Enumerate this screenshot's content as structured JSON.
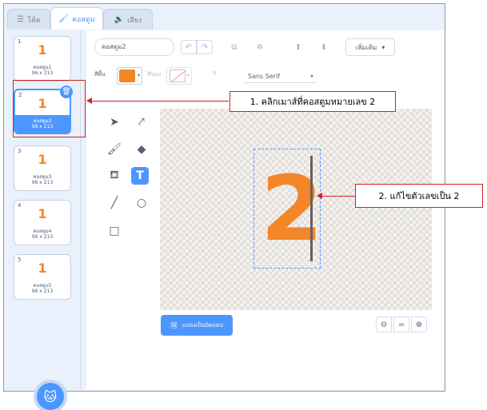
{
  "tabs": [
    {
      "label": "โค้ด",
      "icon": "code-icon"
    },
    {
      "label": "คอสตูม",
      "icon": "brush-icon"
    },
    {
      "label": "เสียง",
      "icon": "speaker-icon"
    }
  ],
  "costumes": [
    {
      "num": "1",
      "glyph": "1",
      "name": "คอสตูม1",
      "size": "96 x 213"
    },
    {
      "num": "2",
      "glyph": "1",
      "name": "คอสตูม2",
      "size": "96 x 213"
    },
    {
      "num": "3",
      "glyph": "1",
      "name": "คอสตูม3",
      "size": "96 x 213"
    },
    {
      "num": "4",
      "glyph": "1",
      "name": "คอสตูม4",
      "size": "96 x 213"
    },
    {
      "num": "5",
      "glyph": "1",
      "name": "คอสตูม5",
      "size": "96 x 213"
    }
  ],
  "editor": {
    "costume_name": "คอสตูม2",
    "more_label": "เพิ่มเติม",
    "fill_label": "สีพื้น",
    "outline_label": "สีขอบ",
    "outline_width": "0",
    "font": "Sans Serif",
    "canvas_text": "2",
    "bitmap_label": "แปลงเป็นบิตแมป",
    "zoom_equal": "="
  },
  "colors": {
    "accent": "#4c97ff",
    "fill": "#f4862a",
    "annotation": "#d32222"
  },
  "annotations": {
    "step1": "1. คลิกเมาส์ที่คอสตูมหมายเลข 2",
    "step2": "2. แก้ไขตัวเลขเป็น 2"
  }
}
